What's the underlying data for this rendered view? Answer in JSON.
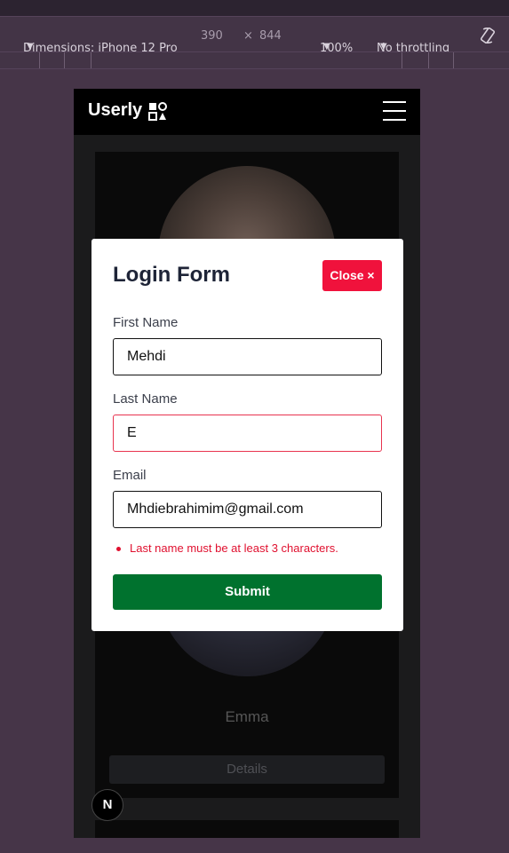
{
  "devtools": {
    "dimensions_label": "Dimensions: iPhone 12 Pro",
    "width": "390",
    "times": "×",
    "height": "844",
    "zoom": "100%",
    "throttling": "No throttling"
  },
  "app": {
    "brand": "Userly",
    "user_name": "Emma",
    "details_label": "Details",
    "badge": "N"
  },
  "modal": {
    "title": "Login Form",
    "close_label": "Close ×",
    "first_name_label": "First Name",
    "first_name_value": "Mehdi",
    "last_name_label": "Last Name",
    "last_name_value": "E",
    "email_label": "Email",
    "email_value": "Mhdiebrahimim@gmail.com",
    "error": "Last name must be at least 3 characters.",
    "submit_label": "Submit"
  },
  "colors": {
    "error": "#e0102f",
    "close_button": "#f0123c",
    "submit_button": "#00722e",
    "page_background": "#463548"
  }
}
